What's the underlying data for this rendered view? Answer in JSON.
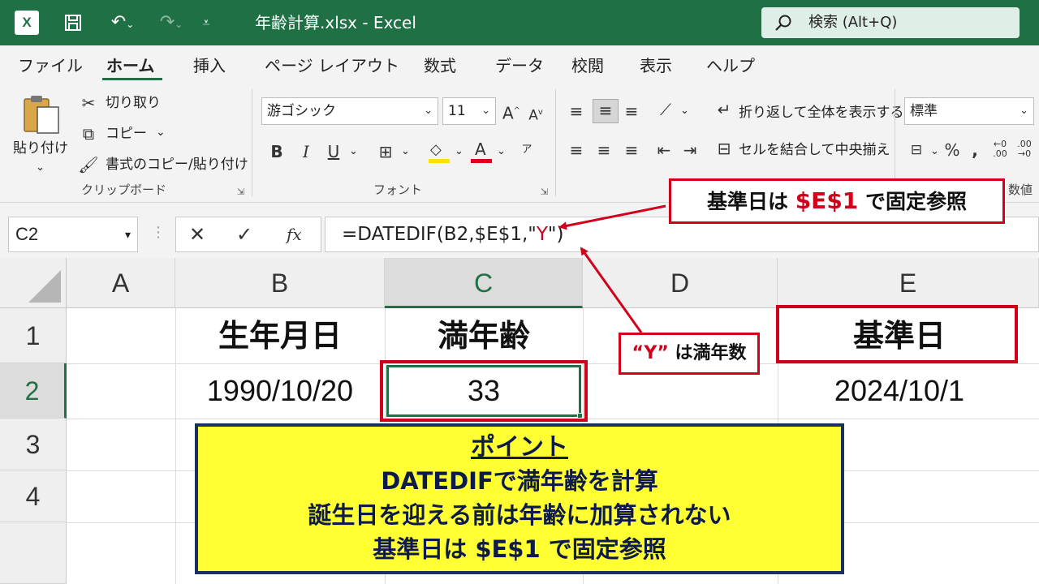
{
  "titlebar": {
    "doc_title": "年齢計算.xlsx  -  Excel",
    "search_placeholder": "検索 (Alt+Q)",
    "icons": [
      "excel-logo",
      "save-icon",
      "undo-icon",
      "redo-icon",
      "customize-icon",
      "search-icon"
    ]
  },
  "tabs": [
    "ファイル",
    "ホーム",
    "挿入",
    "ページ レイアウト",
    "数式",
    "データ",
    "校閲",
    "表示",
    "ヘルプ"
  ],
  "active_tab": "ホーム",
  "ribbon": {
    "clipboard": {
      "paste": "貼り付け",
      "cut": "切り取り",
      "copy": "コピー",
      "format_painter": "書式のコピー/貼り付け",
      "label": "クリップボード"
    },
    "font": {
      "font_name": "游ゴシック",
      "font_size": "11",
      "bold": "B",
      "italic": "I",
      "underline": "U",
      "label": "フォント"
    },
    "alignment": {
      "wrap_text": "折り返して全体を表示する",
      "merge_center": "セルを結合して中央揃え"
    },
    "number": {
      "format": "標準",
      "label": "数値"
    }
  },
  "formula_bar": {
    "name_box": "C2",
    "fx": "fx",
    "formula_prefix": "=DATEDIF(B2,$E$1,\"",
    "formula_arg": "Y",
    "formula_suffix": "\")"
  },
  "sheet": {
    "columns": [
      "A",
      "B",
      "C",
      "D",
      "E"
    ],
    "rows": [
      "1",
      "2",
      "3",
      "4"
    ],
    "selected_cell": "C2",
    "cells": {
      "B1": "生年月日",
      "C1": "満年齢",
      "E1": "基準日",
      "B2": "1990/10/20",
      "C2": "33",
      "E2": "2024/10/1"
    }
  },
  "annotations": {
    "callout_ref_prefix": "基準日は ",
    "callout_ref_highlight": "$E$1",
    "callout_ref_suffix": " で固定参照",
    "callout_y_highlight": "“Y”",
    "callout_y_suffix": " は満年数",
    "point_title": "ポイント",
    "point_lines": [
      "DATEDIFで満年齢を計算",
      "誕生日を迎える前は年齢に加算されない",
      "基準日は $E$1 で固定参照"
    ]
  },
  "colors": {
    "excel_green": "#1f7145",
    "annotation_red": "#d0021b",
    "point_yellow": "#ffff33",
    "point_border": "#1c2f63"
  }
}
